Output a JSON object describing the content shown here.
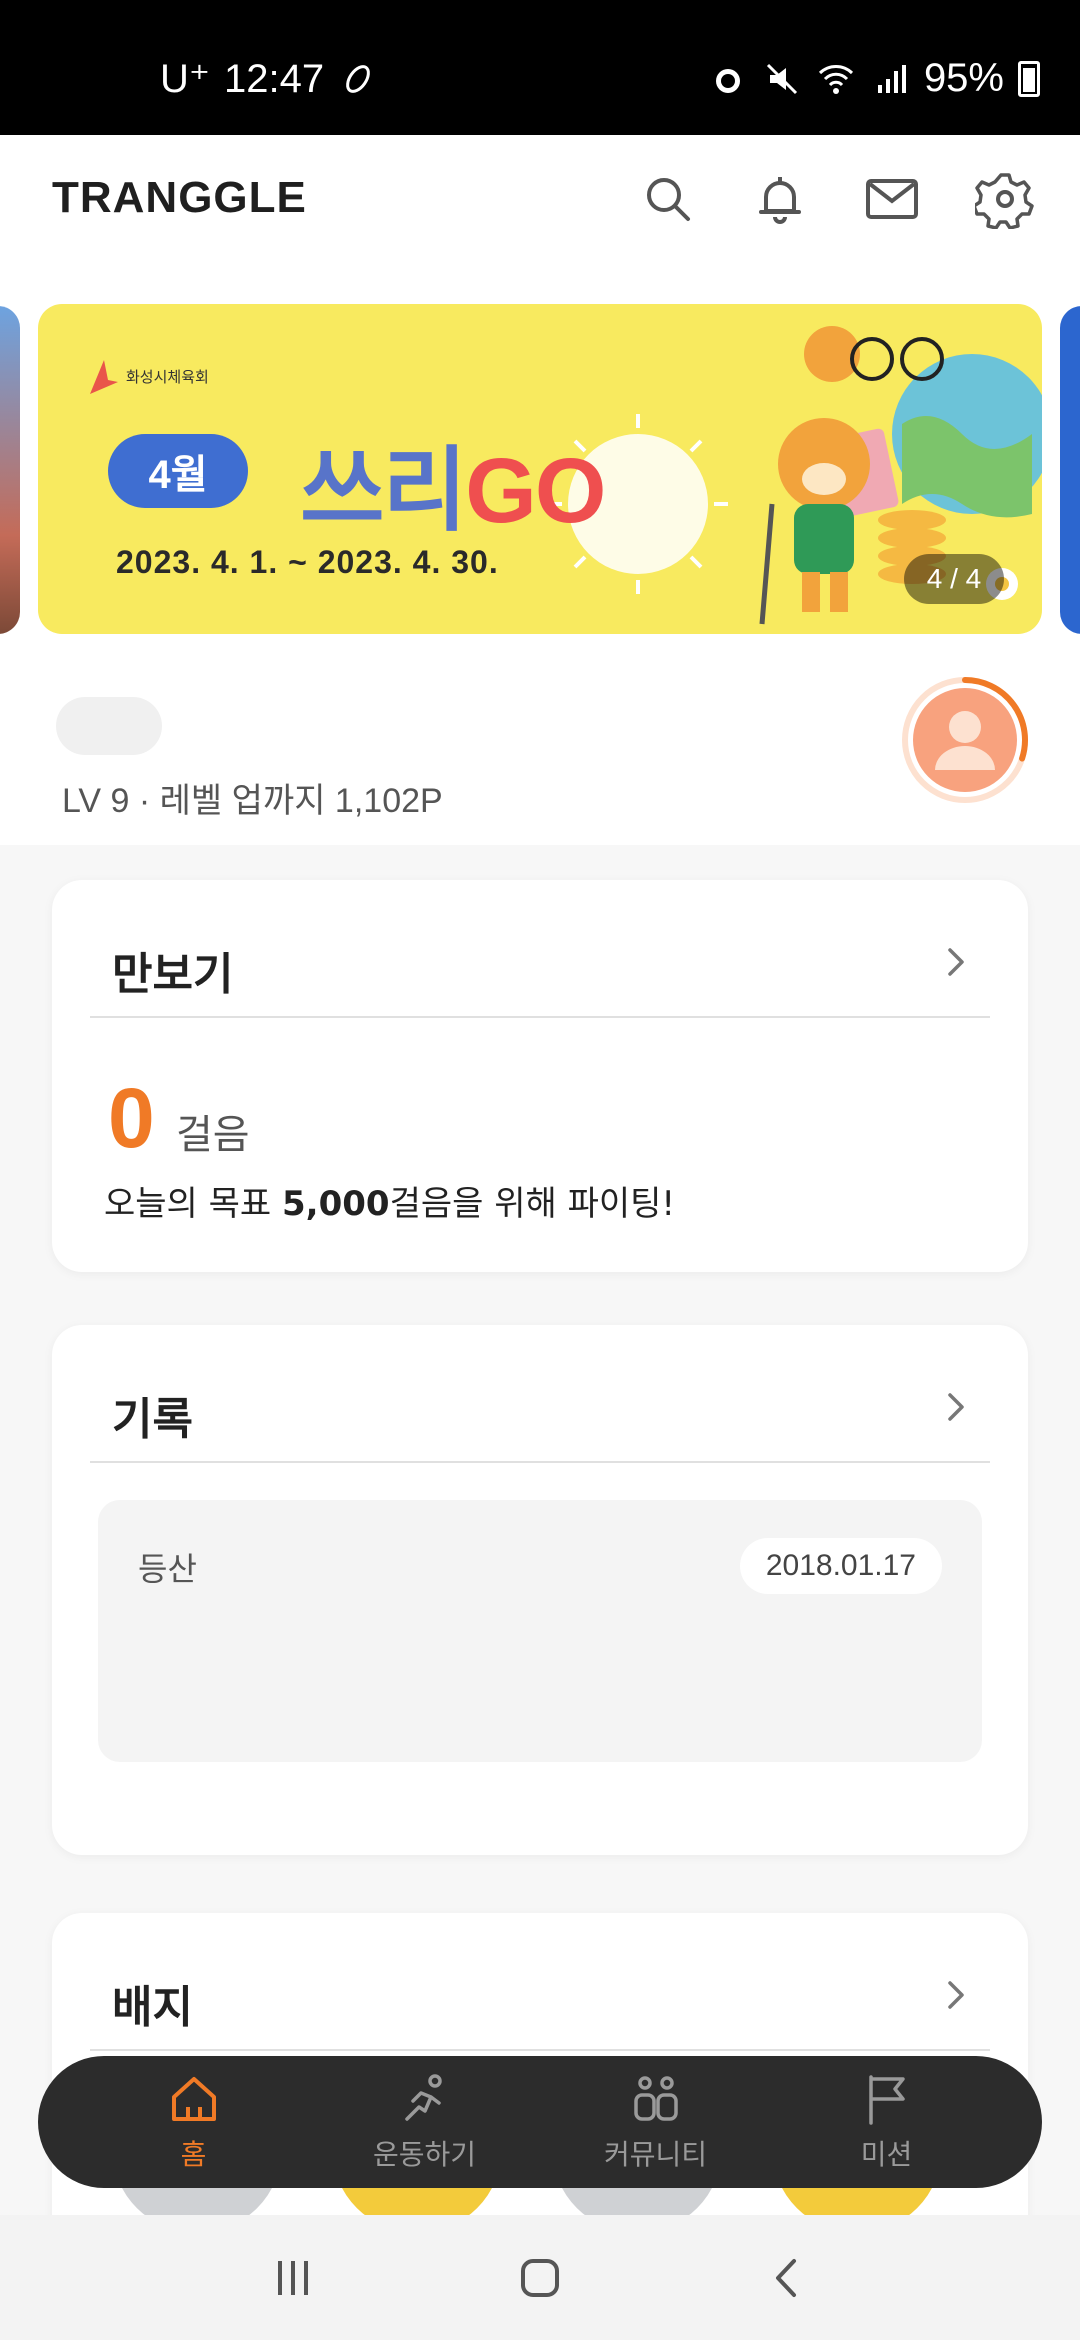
{
  "status_bar": {
    "carrier": "U⁺",
    "time": "12:47",
    "battery": "95%",
    "icons": [
      "runner-shoe-icon",
      "alarm-icon",
      "mute-icon",
      "wifi-icon",
      "signal-icon",
      "battery-icon"
    ]
  },
  "header": {
    "logo": "TRANGGLE",
    "icons": [
      "search-icon",
      "bell-icon",
      "mail-icon",
      "gear-icon"
    ]
  },
  "banner": {
    "org": "화성시체육회",
    "month": "4월",
    "title_part1": "쓰리",
    "title_part2": "GO",
    "date_range": "2023. 4. 1. ~ 2023. 4. 30.",
    "counter": "4 / 4",
    "current_index": 4,
    "total": 4
  },
  "profile": {
    "level_text": "LV 9 · 레벨 업까지 1,102P",
    "progress_to_next_level": 0.3
  },
  "pedometer": {
    "title": "만보기",
    "steps": "0",
    "unit": "걸음",
    "goal_prefix": "오늘의 목표 ",
    "goal_value": "5,000",
    "goal_suffix": "걸음을 위해 파이팅!"
  },
  "records": {
    "title": "기록",
    "item_label": "등산",
    "item_date": "2018.01.17"
  },
  "badges": {
    "title": "배지"
  },
  "bottom_nav": {
    "items": [
      {
        "label": "홈",
        "icon": "home-icon",
        "active": true
      },
      {
        "label": "운동하기",
        "icon": "running-icon",
        "active": false
      },
      {
        "label": "커뮤니티",
        "icon": "community-icon",
        "active": false
      },
      {
        "label": "미션",
        "icon": "flag-icon",
        "active": false
      }
    ]
  },
  "colors": {
    "accent": "#f07a26",
    "banner_bg": "#f8ea5f",
    "nav_bg": "#2c2c2c"
  }
}
